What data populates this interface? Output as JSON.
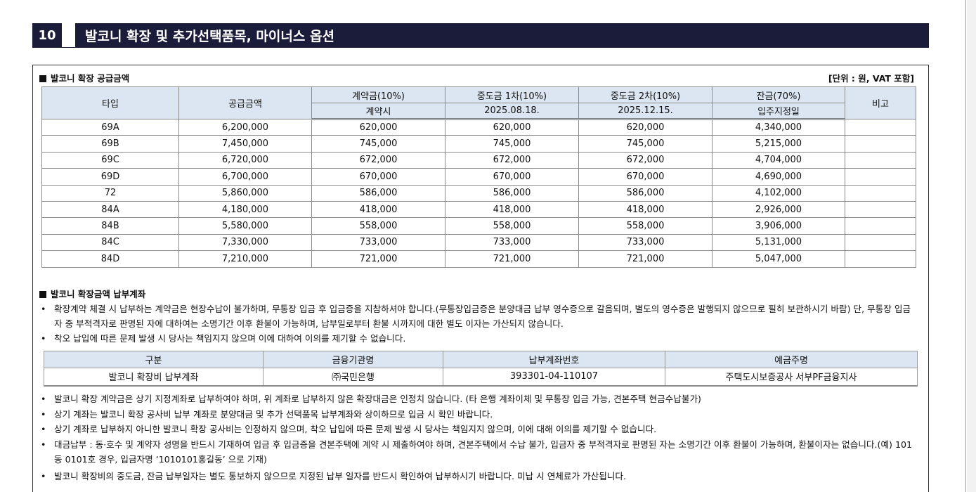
{
  "section": {
    "number": "10",
    "title": "발코니 확장 및 추가선택품목, 마이너스 옵션"
  },
  "supply": {
    "heading": "발코니 확장 공급금액",
    "unit_note": "[단위 : 원, VAT 포함]",
    "headers": {
      "type": "타입",
      "supply_amount": "공급금액",
      "deposit": "계약금(10%)",
      "deposit_when": "계약시",
      "mid1": "중도금 1차(10%)",
      "mid1_date": "2025.08.18.",
      "mid2": "중도금 2차(10%)",
      "mid2_date": "2025.12.15.",
      "balance": "잔금(70%)",
      "balance_when": "입주지정일",
      "remarks": "비고"
    },
    "rows": [
      {
        "type": "69A",
        "supply": "6,200,000",
        "deposit": "620,000",
        "mid1": "620,000",
        "mid2": "620,000",
        "balance": "4,340,000",
        "remarks": ""
      },
      {
        "type": "69B",
        "supply": "7,450,000",
        "deposit": "745,000",
        "mid1": "745,000",
        "mid2": "745,000",
        "balance": "5,215,000",
        "remarks": ""
      },
      {
        "type": "69C",
        "supply": "6,720,000",
        "deposit": "672,000",
        "mid1": "672,000",
        "mid2": "672,000",
        "balance": "4,704,000",
        "remarks": ""
      },
      {
        "type": "69D",
        "supply": "6,700,000",
        "deposit": "670,000",
        "mid1": "670,000",
        "mid2": "670,000",
        "balance": "4,690,000",
        "remarks": ""
      },
      {
        "type": "72",
        "supply": "5,860,000",
        "deposit": "586,000",
        "mid1": "586,000",
        "mid2": "586,000",
        "balance": "4,102,000",
        "remarks": ""
      },
      {
        "type": "84A",
        "supply": "4,180,000",
        "deposit": "418,000",
        "mid1": "418,000",
        "mid2": "418,000",
        "balance": "2,926,000",
        "remarks": ""
      },
      {
        "type": "84B",
        "supply": "5,580,000",
        "deposit": "558,000",
        "mid1": "558,000",
        "mid2": "558,000",
        "balance": "3,906,000",
        "remarks": ""
      },
      {
        "type": "84C",
        "supply": "7,330,000",
        "deposit": "733,000",
        "mid1": "733,000",
        "mid2": "733,000",
        "balance": "5,131,000",
        "remarks": ""
      },
      {
        "type": "84D",
        "supply": "7,210,000",
        "deposit": "721,000",
        "mid1": "721,000",
        "mid2": "721,000",
        "balance": "5,047,000",
        "remarks": ""
      }
    ]
  },
  "payment": {
    "heading": "발코니 확장금액 납부계좌",
    "notes_top": [
      "확장계약 체결 시 납부하는 계약금은 현장수납이 불가하며, 무통장 입금 후 입금증을 지참하셔야 합니다.(무통장입금증은 분양대금 납부 영수증으로 갈음되며, 별도의 영수증은 발행되지 않으므로 필히 보관하시기 바람) 단, 무통장 입금자 중 부적격자로 판명된 자에 대하여는 소명기간 이후 환불이 가능하며, 납부일로부터 환불 시까지에 대한 별도 이자는 가산되지 않습니다.",
      "착오 납입에 따른 문제 발생 시 당사는 책임지지 않으며 이에 대하여 이의를 제기할 수 없습니다."
    ],
    "account_headers": {
      "category": "구분",
      "bank": "금융기관명",
      "account_no": "납부계좌번호",
      "holder": "예금주명"
    },
    "account_row": {
      "category": "발코니 확장비 납부계좌",
      "bank": "㈜국민은행",
      "account_no": "393301-04-110107",
      "holder": "주택도시보증공사 서부PF금융지사"
    },
    "notes_bottom": [
      "발코니 확장 계약금은 상기 지정계좌로 납부하여야 하며, 위 계좌로 납부하지 않은 확장대금은 인정치 않습니다. (타 은행 계좌이체 및 무통장 입금 가능, 견본주택 현금수납불가)",
      "상기 계좌는 발코니 확장 공사비 납부 계좌로 분양대금 및 추가 선택품목 납부계좌와 상이하므로 입금 시 확인 바랍니다.",
      "상기 계좌로 납부하지 아니한 발코니 확장 공사비는 인정하지 않으며, 착오 납입에 따른 문제 발생 시 당사는 책임지지 않으며, 이에 대해 이의를 제기할 수 없습니다.",
      "대금납부 : 동·호수 및 계약자 성명을 반드시 기재하여 입금 후 입금증을 견본주택에 계약 시 제출하여야 하며, 견본주택에서 수납 불가, 입금자 중 부적격자로 판명된 자는 소명기간 이후 환불이 가능하며, 환불이자는 없습니다.(예) 101동 0101호 경우, 입금자명 ‘1010101홍길동’ 으로 기재)",
      "발코니 확장비의 중도금, 잔금 납부일자는 별도 통보하지 않으므로 지정된 납부 일자를 반드시 확인하여 납부하시기 바랍니다. 미납 시 연체료가 가산됩니다."
    ]
  }
}
